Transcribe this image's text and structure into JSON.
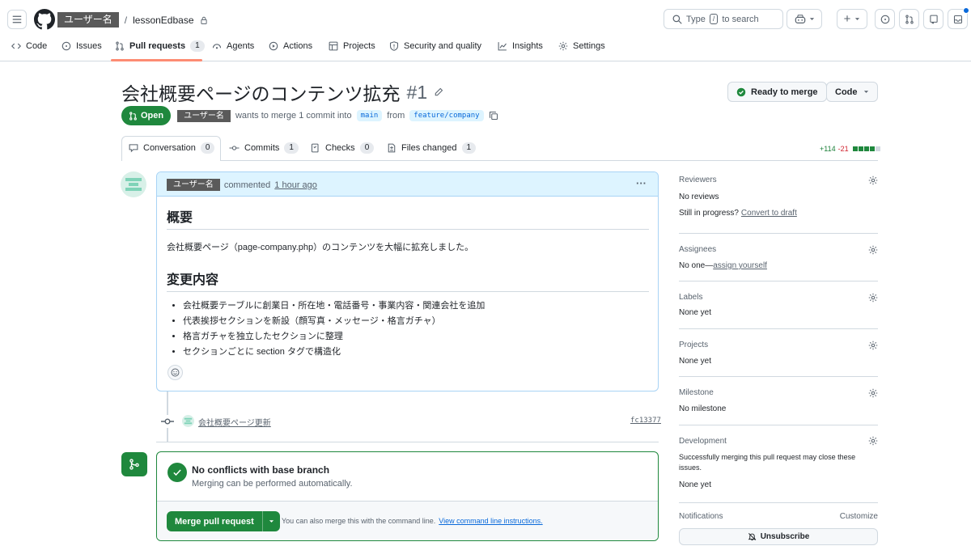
{
  "header": {
    "owner": "ユーザー名",
    "separator": "/",
    "repo": "lessonEdbase",
    "search_placeholder_pre": "Type",
    "search_key": "/",
    "search_placeholder_post": "to search",
    "plus_label": "+"
  },
  "repo_tabs": [
    {
      "label": "Code",
      "icon": "code-icon"
    },
    {
      "label": "Issues",
      "icon": "issue-icon"
    },
    {
      "label": "Pull requests",
      "icon": "pull-request-icon",
      "count": "1"
    },
    {
      "label": "Agents",
      "icon": "agents-icon"
    },
    {
      "label": "Actions",
      "icon": "play-icon"
    },
    {
      "label": "Projects",
      "icon": "table-icon"
    },
    {
      "label": "Security and quality",
      "icon": "shield-icon"
    },
    {
      "label": "Insights",
      "icon": "graph-icon"
    },
    {
      "label": "Settings",
      "icon": "gear-icon"
    }
  ],
  "pr": {
    "title": "会社概要ページのコンテンツ拡充",
    "number": "#1",
    "state": "Open",
    "author": "ユーザー名",
    "meta_text": "wants to merge 1 commit into",
    "base_branch": "main",
    "from_text": "from",
    "head_branch": "feature/company",
    "ready_label": "Ready to merge",
    "code_label": "Code"
  },
  "pr_tabs": [
    {
      "label": "Conversation",
      "count": "0"
    },
    {
      "label": "Commits",
      "count": "1"
    },
    {
      "label": "Checks",
      "count": "0"
    },
    {
      "label": "Files changed",
      "count": "1"
    }
  ],
  "diffstat": {
    "additions": "+114",
    "deletions": "-21"
  },
  "comment": {
    "author": "ユーザー名",
    "action": "commented",
    "time": "1 hour ago",
    "menu": "···",
    "h1": "概要",
    "paragraph": "会社概要ページ（page-company.php）のコンテンツを大幅に拡充しました。",
    "h2": "変更内容",
    "bullets": [
      "会社概要テーブルに創業日・所在地・電話番号・事業内容・関連会社を追加",
      "代表挨拶セクションを新設（顔写真・メッセージ・格言ガチャ）",
      "格言ガチャを独立したセクションに整理",
      "セクションごとに section タグで構造化"
    ]
  },
  "commit": {
    "message": "会社概要ページ更新",
    "sha": "fc13377"
  },
  "merge": {
    "title": "No conflicts with base branch",
    "subtitle": "Merging can be performed automatically.",
    "button": "Merge pull request",
    "hint": "You can also merge this with the command line.",
    "hint_link": "View command line instructions."
  },
  "sidebar": {
    "reviewers": {
      "title": "Reviewers",
      "value": "No reviews",
      "note": "Still in progress?",
      "link": "Convert to draft"
    },
    "assignees": {
      "title": "Assignees",
      "value": "No one—",
      "link": "assign yourself"
    },
    "labels": {
      "title": "Labels",
      "value": "None yet"
    },
    "projects": {
      "title": "Projects",
      "value": "None yet"
    },
    "milestone": {
      "title": "Milestone",
      "value": "No milestone"
    },
    "development": {
      "title": "Development",
      "note": "Successfully merging this pull request may close these issues.",
      "value": "None yet"
    },
    "notifications": {
      "title": "Notifications",
      "customize": "Customize",
      "button": "Unsubscribe"
    }
  },
  "colors": {
    "accent": "#1f883d",
    "link": "#0969da",
    "tab_underline": "#fd8c73",
    "danger": "#d1242f"
  }
}
